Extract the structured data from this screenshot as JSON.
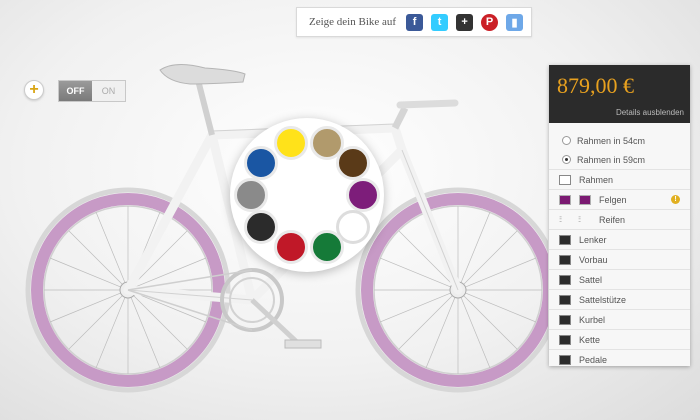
{
  "share": {
    "label": "Zeige dein Bike auf",
    "icons": [
      {
        "name": "facebook-icon",
        "glyph": "f",
        "color": "#3b5998"
      },
      {
        "name": "twitter-icon",
        "glyph": "t",
        "color": "#33ccff"
      },
      {
        "name": "googleplus-icon",
        "glyph": "+",
        "color": "#333333"
      },
      {
        "name": "pinterest-icon",
        "glyph": "P",
        "color": "#cb2027"
      },
      {
        "name": "save-icon",
        "glyph": "▮",
        "color": "#6ea8e8"
      }
    ]
  },
  "toggle": {
    "off": "OFF",
    "on": "ON"
  },
  "plus_glyph": "+",
  "colors": {
    "frame": "#f2f2f2",
    "rim": "#c79ac6",
    "accent": "#e8a11f"
  },
  "picker": {
    "swatches": [
      "#ffe21a",
      "#b19a6c",
      "#5a3a18",
      "#1a56a3",
      "#7d1d7a",
      "#8a8a8a",
      "#ffffff",
      "#2b2b2b",
      "#c01828",
      "#157a38"
    ]
  },
  "panel": {
    "price": "879,00 €",
    "details": "Details ausblenden",
    "sizes": [
      {
        "label": "Rahmen in 54cm",
        "selected": false
      },
      {
        "label": "Rahmen in 59cm",
        "selected": true
      }
    ],
    "parts": {
      "rahmen": "Rahmen",
      "felgen": "Felgen",
      "reifen": "Reifen",
      "lenker": "Lenker",
      "vorbau": "Vorbau",
      "sattel": "Sattel",
      "sattelstuetze": "Sattelstütze",
      "kurbel": "Kurbel",
      "kette": "Kette",
      "pedale": "Pedale"
    },
    "warn_glyph": "!"
  }
}
